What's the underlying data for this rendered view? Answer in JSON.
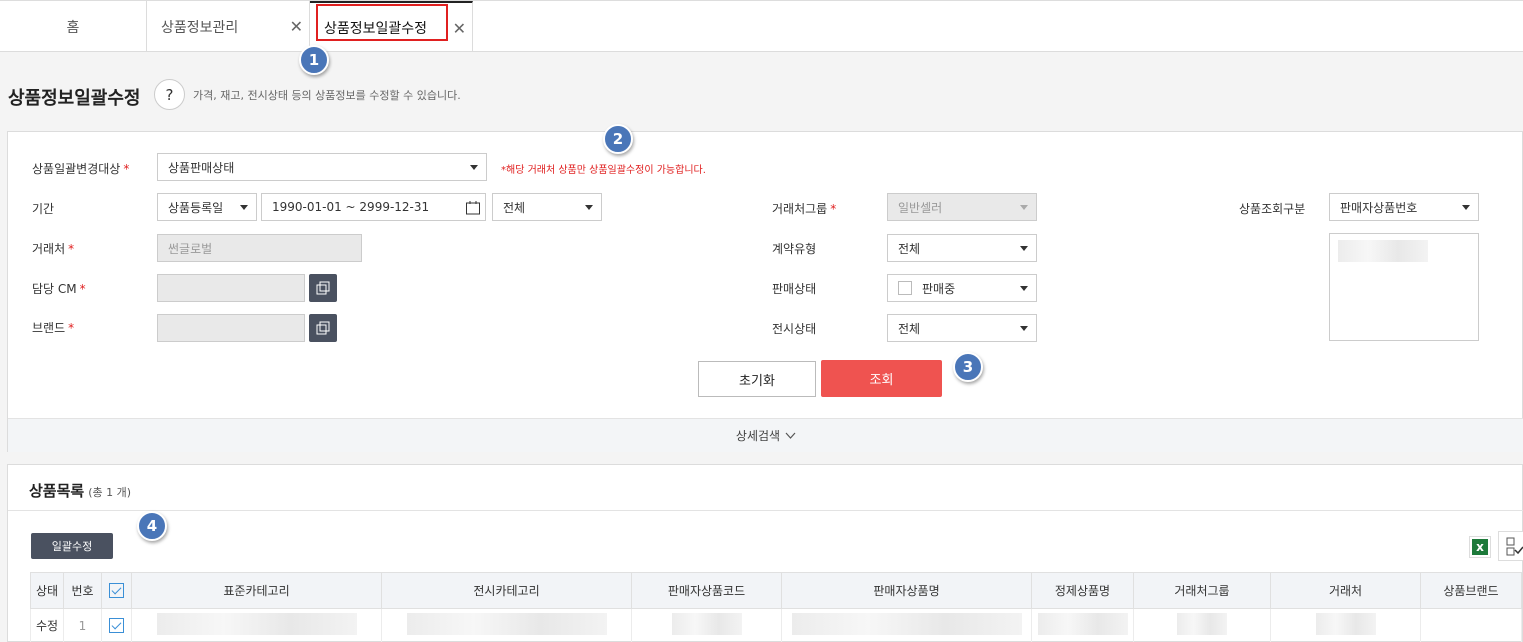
{
  "tabs": [
    {
      "label": "홈"
    },
    {
      "label": "상품정보관리"
    },
    {
      "label": "상품정보일괄수정"
    }
  ],
  "badges": [
    "1",
    "2",
    "3",
    "4"
  ],
  "page": {
    "title": "상품정보일괄수정",
    "help": "?",
    "description": "가격, 재고, 전시상태 등의 상품정보를 수정할 수 있습니다."
  },
  "search": {
    "target_label": "상품일괄변경대상",
    "target_value": "상품판매상태",
    "notice": "*해당 거래처 상품만 상품일괄수정이 가능합니다.",
    "period_label": "기간",
    "period_type": "상품등록일",
    "period_range": "1990-01-01 ~ 2999-12-31",
    "period_extra": "전체",
    "vendor_label": "거래처",
    "vendor_value": "썬글로벌",
    "cm_label": "담당 CM",
    "brand_label": "브랜드",
    "vendor_group_label": "거래처그룹",
    "vendor_group_value": "일반셀러",
    "contract_label": "계약유형",
    "contract_value": "전체",
    "sale_status_label": "판매상태",
    "sale_status_value": "판매중",
    "display_status_label": "전시상태",
    "display_status_value": "전체",
    "lookup_label": "상품조회구분",
    "lookup_value": "판매자상품번호",
    "reset_label": "초기화",
    "search_label": "조회",
    "detail_label": "상세검색"
  },
  "list": {
    "title": "상품목록",
    "count": "(총 1 개)",
    "bulk_edit_label": "일괄수정",
    "excel_icon_text": "x",
    "columns": [
      "상태",
      "번호",
      "",
      "표준카테고리",
      "전시카테고리",
      "판매자상품코드",
      "판매자상품명",
      "정제상품명",
      "거래처그룹",
      "거래처",
      "상품브랜드"
    ],
    "rows": [
      {
        "status": "수정",
        "no": "1"
      }
    ]
  },
  "colors": {
    "accent_red": "#ef5350",
    "highlight_red": "#e02020",
    "badge_blue": "#4a76b8",
    "dark_button": "#4a5160"
  }
}
